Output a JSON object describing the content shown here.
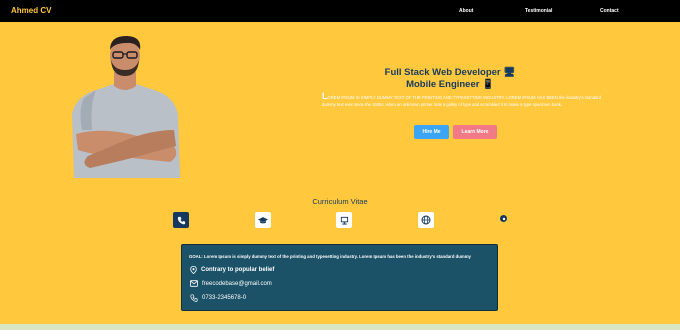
{
  "navbar": {
    "brand": "Ahmed CV",
    "links": [
      "About",
      "Testimonial",
      "Contact"
    ]
  },
  "hero": {
    "title_line1": "Full Stack Web Developer 🖥",
    "title_line2": "Mobile Engineer 📱",
    "dropcap": "L",
    "description": "OREM IPSUM IS SIMPLY DUMMY TEXT OF THE PRINTING AND TYPESETTING INDUSTRY. LOREM IPSUM HAS BEEN the industry's standard dummy text ever since the 1500s, when an unknown printer took a galley of type and scrambled it to make a type specimen book.",
    "buttons": {
      "hire": "Hire Me",
      "learn": "Learn More"
    }
  },
  "cv": {
    "title": "Curriculum Vitae",
    "icons": [
      "phone-icon",
      "graduation-cap-icon",
      "desktop-icon",
      "globe-icon",
      "circle-icon"
    ]
  },
  "card": {
    "goal": "GOAL: Lorem Ipsum is simply dummy text of the printing and typesetting industry. Lorem Ipsum has been the industry's standard dummy",
    "location": "Contrary to popular belief",
    "email": "freecodebase@gmail.com",
    "phone": "0733-2345678-0"
  },
  "colors": {
    "background": "#ffc83d",
    "navbar": "#000000",
    "brand": "#ffc83d",
    "heading": "#163a5f",
    "card": "#1b5268",
    "hire_button": "#3aa5f5",
    "learn_button": "#f27a86"
  }
}
